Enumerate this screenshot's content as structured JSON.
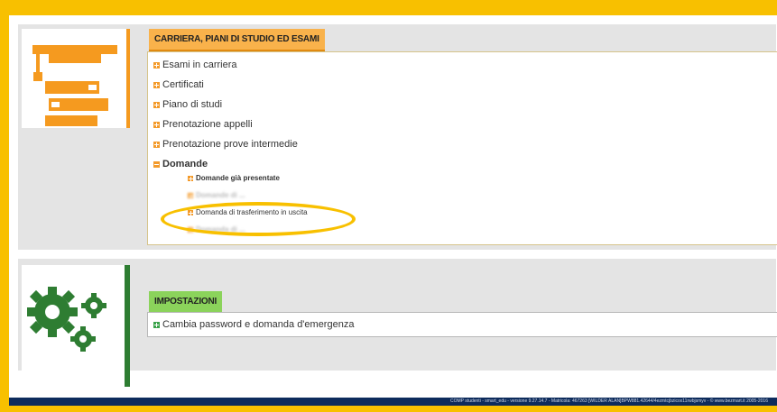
{
  "career": {
    "title": "CARRIERA, PIANI DI STUDIO ED ESAMI",
    "items": [
      {
        "label": "Esami in carriera"
      },
      {
        "label": "Certificati"
      },
      {
        "label": "Piano di studi"
      },
      {
        "label": "Prenotazione appelli"
      },
      {
        "label": "Prenotazione prove intermedie"
      },
      {
        "label": "Domande"
      }
    ],
    "sub_items": [
      {
        "label": "Domande già presentate"
      },
      {
        "label": "Domande di ..."
      },
      {
        "label": "Domanda di trasferimento in uscita"
      },
      {
        "label": "Domanda di ..."
      }
    ]
  },
  "settings": {
    "title": "IMPOSTAZIONI",
    "items": [
      {
        "label": "Cambia password e domanda d'emergenza"
      }
    ]
  },
  "footer": {
    "text": "COMP studenti - smart_edu - versione 9.27.14.7 - Matricola: 467263 [WILDER ALAN]BPW881.42644/4ezmtcjbzicox11rwbjsmyv - © www.bezmart.it 2005-2016"
  },
  "colors": {
    "accent_orange": "#f59a1f",
    "accent_green": "#2e7d32",
    "highlight": "#f8c000",
    "footer_bg": "#0d2b5c"
  },
  "icons": [
    "graduation-books-icon",
    "gears-icon",
    "expand-square-icon"
  ]
}
